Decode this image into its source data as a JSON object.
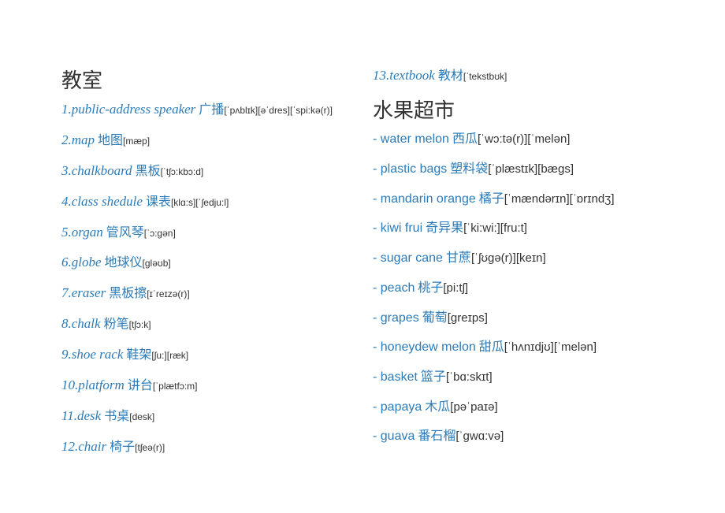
{
  "left": {
    "heading": "教室",
    "items": [
      {
        "num": "1.",
        "word": "public-address speaker",
        "cn": " 广播",
        "ipa": "[ˈpʌblɪk][əˈdres][ˈspi:kə(r)]"
      },
      {
        "num": "2.",
        "word": "map",
        "cn": " 地图",
        "ipa": "[mæp]"
      },
      {
        "num": "3.",
        "word": "chalkboard",
        "cn": " 黑板",
        "ipa": "[ˈtʃɔ:kbɔ:d]"
      },
      {
        "num": "4.",
        "word": "class shedule",
        "cn": " 课表",
        "ipa": "[klɑ:s][ˈʃedju:l]"
      },
      {
        "num": "5.",
        "word": "organ",
        "cn": " 管风琴",
        "ipa": "[ˈɔ:gən]"
      },
      {
        "num": "6.",
        "word": "globe",
        "cn": " 地球仪",
        "ipa": "[gləʊb]"
      },
      {
        "num": "7.",
        "word": "eraser",
        "cn": " 黑板擦",
        "ipa": "[ɪˈreɪzə(r)]"
      },
      {
        "num": "8.",
        "word": "chalk",
        "cn": " 粉笔",
        "ipa": "[tʃɔ:k]"
      },
      {
        "num": "9.",
        "word": "shoe rack",
        "cn": " 鞋架",
        "ipa": "[ʃu:][ræk]"
      },
      {
        "num": "10.",
        "word": "platform",
        "cn": " 讲台",
        "ipa": "[ˈplætfɔ:m]"
      },
      {
        "num": "11.",
        "word": "desk",
        "cn": " 书桌",
        "ipa": "[desk]"
      },
      {
        "num": "12.",
        "word": "chair",
        "cn": " 椅子",
        "ipa": "[tʃeə(r)]"
      }
    ]
  },
  "right": {
    "top": {
      "num": "13.",
      "word": "textbook",
      "cn": " 教材",
      "ipa": "[ˈtekstbʊk]"
    },
    "heading": "水果超市",
    "items": [
      {
        "word": "water melon",
        "cn": "  西瓜",
        "ipa": "[ˈwɔ:tə(r)][ˈmelən]"
      },
      {
        "word": "plastic bags",
        "cn": "  塑料袋",
        "ipa": "[ˈplæstɪk][bægs]"
      },
      {
        "word": "mandarin orange",
        "cn": "  橘子",
        "ipa": "[ˈmændərɪn][ˈɒrɪndʒ]"
      },
      {
        "word": "kiwi frui",
        "cn": "  奇异果",
        "ipa": "[ˈki:wi:][fru:t]"
      },
      {
        "word": "sugar cane",
        "cn": "  甘蔗",
        "ipa": "[ˈʃʊgə(r)][keɪn]"
      },
      {
        "word": "peach",
        "cn": "  桃子",
        "ipa": "[pi:tʃ]"
      },
      {
        "word": "grapes",
        "cn": "  葡萄",
        "ipa": "[greɪps]"
      },
      {
        "word": "honeydew melon",
        "cn": "  甜瓜",
        "ipa": "[ˈhʌnɪdjʊ][ˈmelən]"
      },
      {
        "word": "basket",
        "cn": "  篮子",
        "ipa": "[ˈbɑ:skɪt]"
      },
      {
        "word": "papaya",
        "cn": "  木瓜",
        "ipa": "[pəˈpaɪə]"
      },
      {
        "word": "guava",
        "cn": "  番石榴",
        "ipa": "[ˈgwɑ:və]"
      }
    ]
  }
}
